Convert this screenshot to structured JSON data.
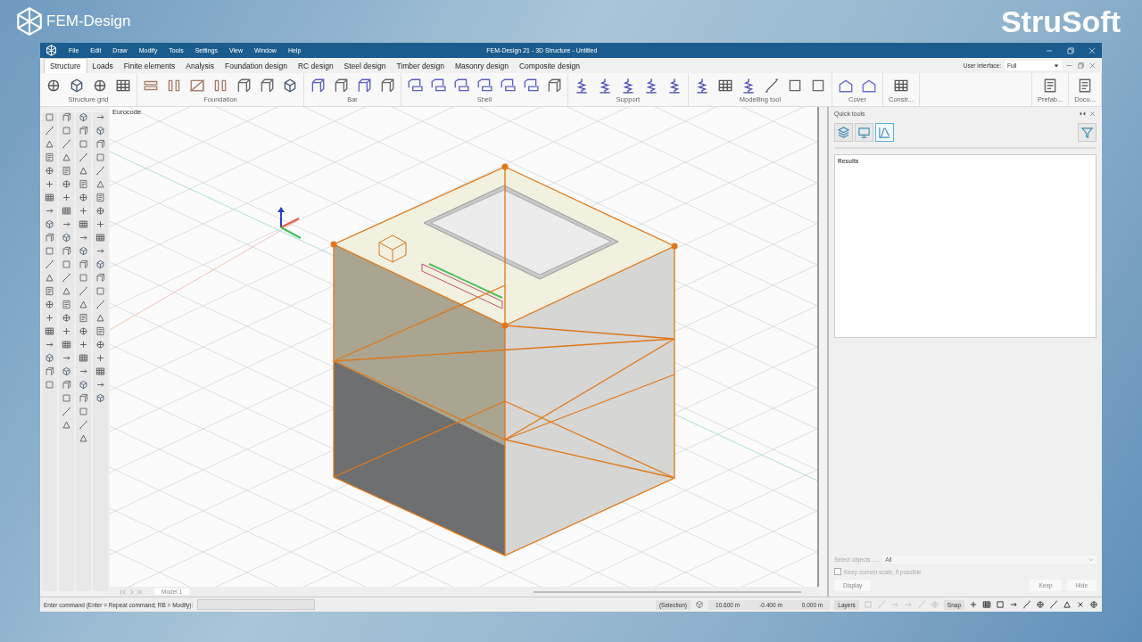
{
  "brand": {
    "product": "FEM-Design",
    "company": "StruSoft"
  },
  "window": {
    "title": "FEM-Design 21 - 3D Structure - Untitled",
    "menu": [
      "File",
      "Edit",
      "Draw",
      "Modify",
      "Tools",
      "Settings",
      "View",
      "Window",
      "Help"
    ]
  },
  "tabs": [
    {
      "label": "Structure",
      "selected": true
    },
    {
      "label": "Loads",
      "selected": false
    },
    {
      "label": "Finite elements",
      "selected": false
    },
    {
      "label": "Analysis",
      "selected": false
    },
    {
      "label": "Foundation design",
      "selected": false
    },
    {
      "label": "RC design",
      "selected": false
    },
    {
      "label": "Steel design",
      "selected": false
    },
    {
      "label": "Timber design",
      "selected": false
    },
    {
      "label": "Masonry design",
      "selected": false
    },
    {
      "label": "Composite design",
      "selected": false
    }
  ],
  "user_interface": {
    "label": "User interface:",
    "value": "Full"
  },
  "ribbon_groups": [
    {
      "label": "Structure grid"
    },
    {
      "label": "Foundation"
    },
    {
      "label": "Bar"
    },
    {
      "label": "Shell"
    },
    {
      "label": "Support"
    },
    {
      "label": "Modelling tool"
    },
    {
      "label": "Cover"
    },
    {
      "label": "Constr..."
    },
    {
      "label": "Prefab..."
    },
    {
      "label": "Docu..."
    }
  ],
  "canvas": {
    "standard": "Eurocode",
    "sheet_tab": "Model 1"
  },
  "quick_tools": {
    "title": "Quick tools",
    "modes": [
      {
        "selected": false
      },
      {
        "selected": false
      },
      {
        "selected": true
      }
    ],
    "results_title": "Results",
    "select_label": "Select objects .....",
    "select_value": "All",
    "keep_scale": {
      "label": "Keep current scale, if possible",
      "checked": false
    },
    "buttons": [
      "Display",
      "Keep",
      "Hide"
    ]
  },
  "status_bar": {
    "prompt": "Enter command (Enter = Repeat command; RB = Modify):",
    "selection": "(Selection)",
    "coordinates": [
      "10.600 m",
      "-0.400 m",
      "0.000 m"
    ],
    "layers": "Layers",
    "snap": "Snap"
  }
}
